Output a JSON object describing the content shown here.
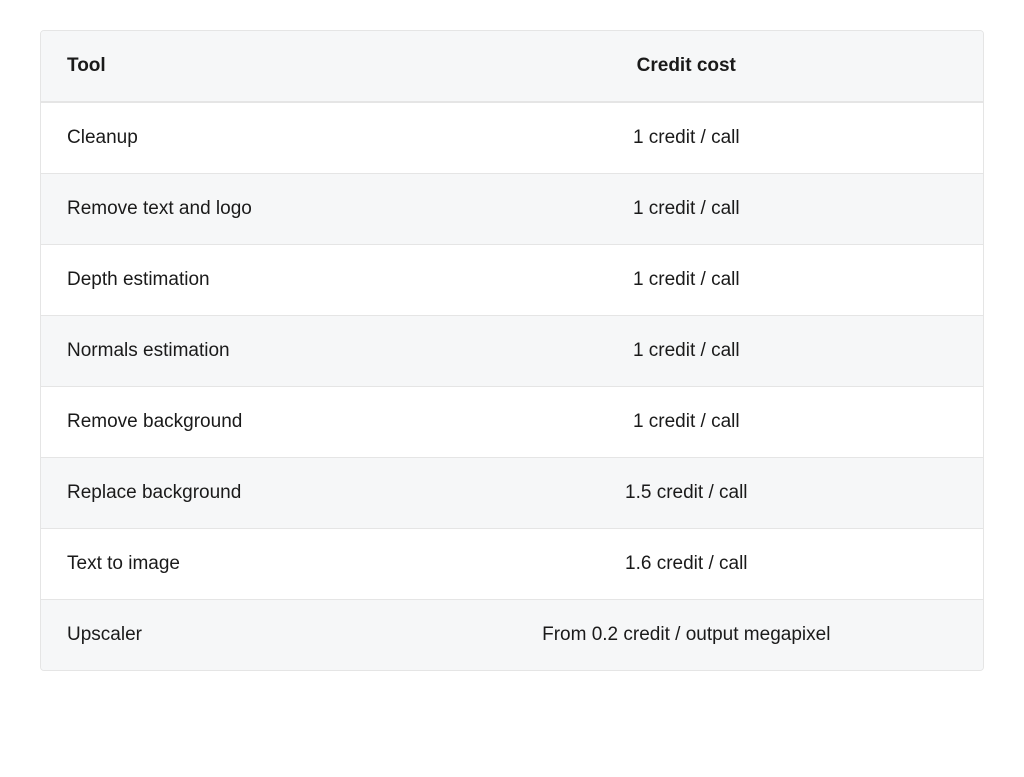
{
  "table": {
    "headers": {
      "tool": "Tool",
      "credit_cost": "Credit cost"
    },
    "rows": [
      {
        "tool": "Cleanup",
        "credit_cost": "1 credit / call"
      },
      {
        "tool": "Remove text and logo",
        "credit_cost": "1 credit / call"
      },
      {
        "tool": "Depth estimation",
        "credit_cost": "1 credit / call"
      },
      {
        "tool": "Normals estimation",
        "credit_cost": "1 credit / call"
      },
      {
        "tool": "Remove background",
        "credit_cost": "1 credit / call"
      },
      {
        "tool": "Replace background",
        "credit_cost": "1.5 credit / call"
      },
      {
        "tool": "Text to image",
        "credit_cost": "1.6 credit / call"
      },
      {
        "tool": "Upscaler",
        "credit_cost": "From 0.2 credit / output megapixel"
      }
    ]
  }
}
